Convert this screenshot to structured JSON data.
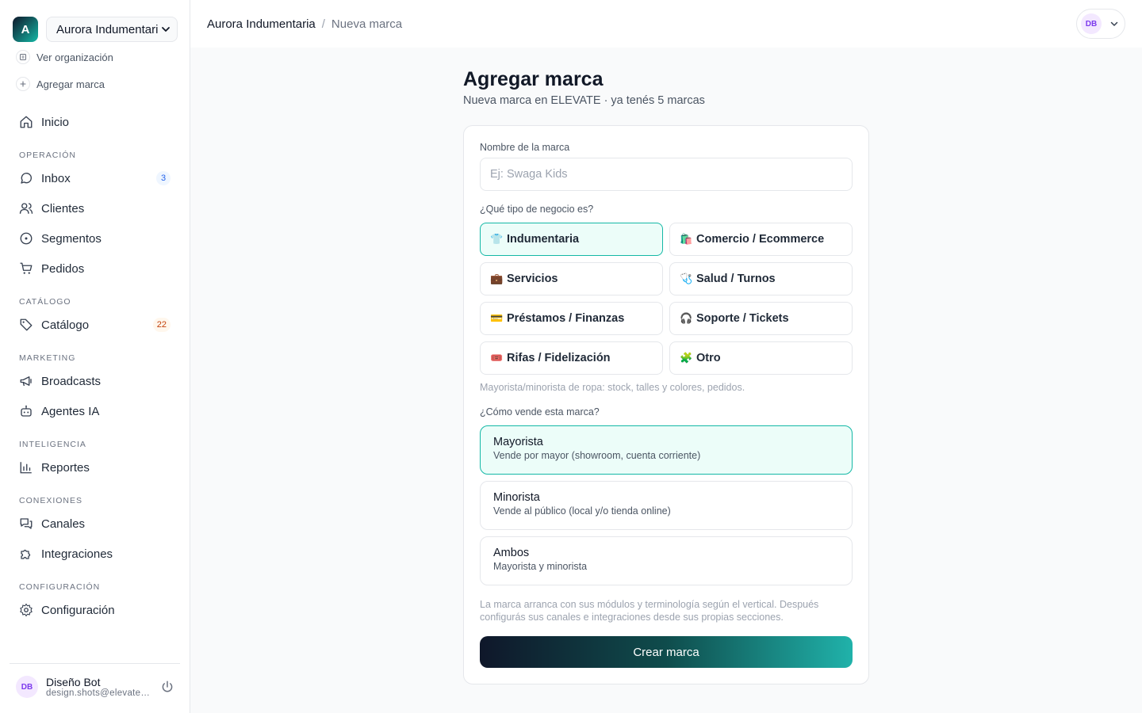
{
  "org": {
    "initial": "A",
    "name": "Aurora Indumentaria",
    "view_link": "Ver organización",
    "add_brand_link": "Agregar marca"
  },
  "nav": {
    "home": "Inicio",
    "sections": {
      "operacion": "OPERACIÓN",
      "catalogo": "CATÁLOGO",
      "marketing": "MARKETING",
      "inteligencia": "INTELIGENCIA",
      "conexiones": "CONEXIONES",
      "configuracion": "CONFIGURACIÓN"
    },
    "items": {
      "inbox": "Inbox",
      "inbox_badge": "3",
      "clientes": "Clientes",
      "segmentos": "Segmentos",
      "pedidos": "Pedidos",
      "catalogo": "Catálogo",
      "catalogo_badge": "22",
      "broadcasts": "Broadcasts",
      "agentes": "Agentes IA",
      "reportes": "Reportes",
      "canales": "Canales",
      "integraciones": "Integraciones",
      "configuracion": "Configuración"
    }
  },
  "user": {
    "initials": "DB",
    "name": "Diseño Bot",
    "email": "design.shots@elevate.app"
  },
  "breadcrumb": {
    "org": "Aurora Indumentaria",
    "separator": "/",
    "current": "Nueva marca"
  },
  "page": {
    "title": "Agregar marca",
    "subtitle": "Nueva marca en ELEVATE · ya tenés 5 marcas"
  },
  "form": {
    "name_label": "Nombre de la marca",
    "name_placeholder": "Ej: Swaga Kids",
    "name_value": "",
    "type_label": "¿Qué tipo de negocio es?",
    "types": [
      {
        "emoji": "👕",
        "label": "Indumentaria",
        "selected": true
      },
      {
        "emoji": "🛍️",
        "label": "Comercio / Ecommerce",
        "selected": false
      },
      {
        "emoji": "💼",
        "label": "Servicios",
        "selected": false
      },
      {
        "emoji": "🩺",
        "label": "Salud / Turnos",
        "selected": false
      },
      {
        "emoji": "💳",
        "label": "Préstamos / Finanzas",
        "selected": false
      },
      {
        "emoji": "🎧",
        "label": "Soporte / Tickets",
        "selected": false
      },
      {
        "emoji": "🎟️",
        "label": "Rifas / Fidelización",
        "selected": false
      },
      {
        "emoji": "🧩",
        "label": "Otro",
        "selected": false
      }
    ],
    "type_hint": "Mayorista/minorista de ropa: stock, talles y colores, pedidos.",
    "sale_label": "¿Cómo vende esta marca?",
    "sale_options": [
      {
        "title": "Mayorista",
        "desc": "Vende por mayor (showroom, cuenta corriente)",
        "selected": true
      },
      {
        "title": "Minorista",
        "desc": "Vende al público (local y/o tienda online)",
        "selected": false
      },
      {
        "title": "Ambos",
        "desc": "Mayorista y minorista",
        "selected": false
      }
    ],
    "footer_note": "La marca arranca con sus módulos y terminología según el vertical. Después configurás sus canales e integraciones desde sus propias secciones.",
    "submit_label": "Crear marca"
  },
  "colors": {
    "accent": "#14b8a6",
    "accent_bg": "#ecfdf9"
  }
}
